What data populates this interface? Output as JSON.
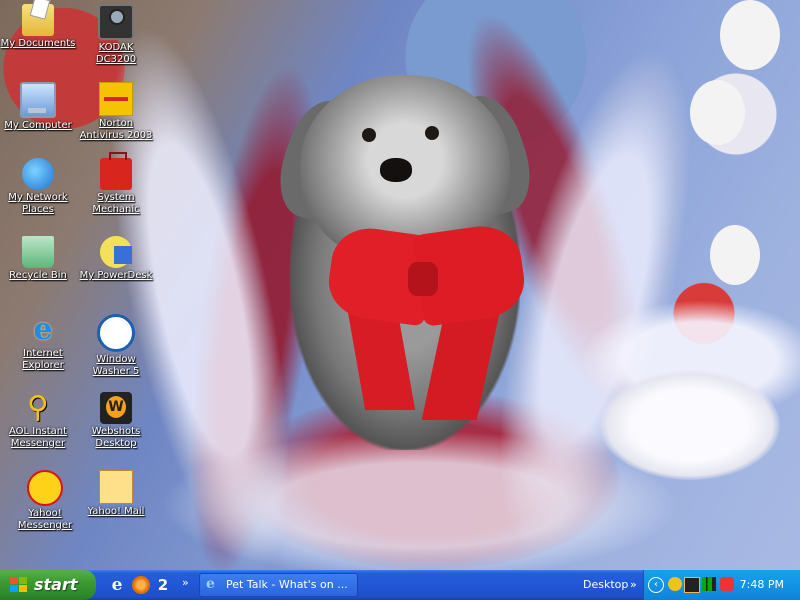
{
  "desktop": {
    "icons": [
      {
        "id": "my-documents",
        "label": "My Documents"
      },
      {
        "id": "kodak",
        "label": "KODAK DC3200"
      },
      {
        "id": "my-computer",
        "label": "My Computer"
      },
      {
        "id": "norton",
        "label": "Norton Antivirus 2003"
      },
      {
        "id": "my-network",
        "label": "My Network Places"
      },
      {
        "id": "system-mechanic",
        "label": "System Mechanic"
      },
      {
        "id": "recycle-bin",
        "label": "Recycle Bin"
      },
      {
        "id": "my-powerdesk",
        "label": "My PowerDesk"
      },
      {
        "id": "internet-explorer",
        "label": "Internet Explorer"
      },
      {
        "id": "window-washer",
        "label": "Window Washer 5"
      },
      {
        "id": "aol-im",
        "label": "AOL Instant Messenger"
      },
      {
        "id": "webshots",
        "label": "Webshots Desktop"
      },
      {
        "id": "yahoo-messenger",
        "label": "Yahoo! Messenger"
      },
      {
        "id": "yahoo-mail",
        "label": "Yahoo! Mail"
      }
    ]
  },
  "taskbar": {
    "start_label": "start",
    "quick_launch": [
      {
        "icon": "internet-explorer-icon",
        "glyph": "e"
      },
      {
        "icon": "media-player-icon",
        "glyph": ""
      },
      {
        "icon": "messenger-icon",
        "glyph": "2"
      }
    ],
    "chevron": "»",
    "task_button": "Pet Talk - What's on ...",
    "desktop_toolbar": "Desktop",
    "desktop_chevron": "»",
    "tray_arrow": "‹",
    "clock": "7:48 PM"
  },
  "colors": {
    "taskbar_blue": "#245edb",
    "start_green": "#3c9a34",
    "tray_blue": "#1494e6"
  }
}
